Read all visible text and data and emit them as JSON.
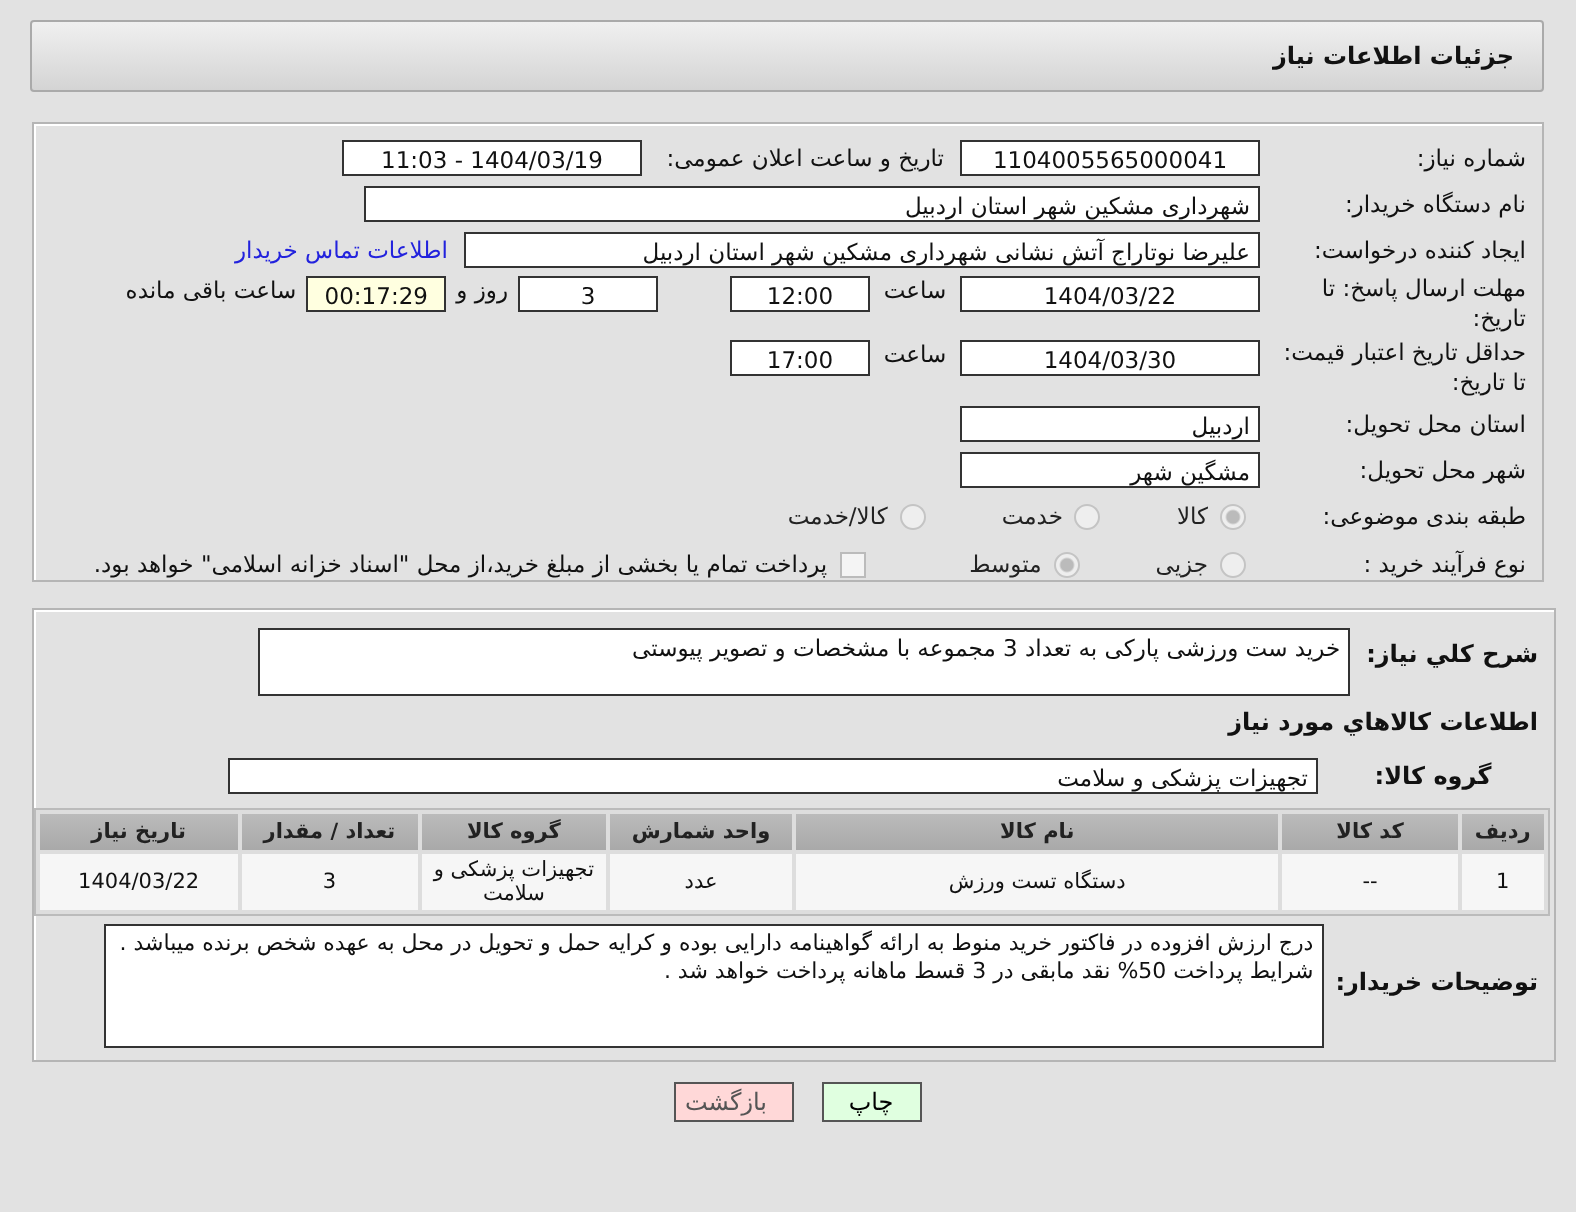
{
  "header": {
    "title": "جزئیات اطلاعات نیاز"
  },
  "need_number": {
    "label": "شماره نیاز:",
    "value": "1104005565000041"
  },
  "announce": {
    "label": "تاریخ و ساعت اعلان عمومی:",
    "value": "1404/03/19 - 11:03"
  },
  "buyer_org": {
    "label": "نام دستگاه خریدار:",
    "value": "شهرداری مشکین شهر استان اردبیل"
  },
  "requester": {
    "label": "ایجاد کننده درخواست:",
    "value": "علیرضا نوتاراج آتش نشانی شهرداری مشکین شهر استان اردبیل",
    "link": "اطلاعات تماس خریدار"
  },
  "deadline": {
    "label": "مهلت ارسال پاسخ: تا تاریخ:",
    "date": "1404/03/22",
    "time_label": "ساعت",
    "time": "12:00",
    "days": "3",
    "days_label": "روز و",
    "remaining": "00:17:29",
    "remaining_label": "ساعت باقی مانده"
  },
  "validity": {
    "label": "حداقل تاریخ اعتبار قیمت: تا تاریخ:",
    "date": "1404/03/30",
    "time_label": "ساعت",
    "time": "17:00"
  },
  "province": {
    "label": "استان محل تحویل:",
    "value": "اردبیل"
  },
  "city": {
    "label": "شهر محل تحویل:",
    "value": "مشگین شهر"
  },
  "category": {
    "label": "طبقه بندی موضوعی:",
    "options": [
      {
        "label": "کالا",
        "selected": true
      },
      {
        "label": "خدمت",
        "selected": false
      },
      {
        "label": "کالا/خدمت",
        "selected": false
      }
    ]
  },
  "purchase_type": {
    "label": "نوع فرآیند خرید :",
    "options": [
      {
        "label": "جزیی",
        "selected": false
      },
      {
        "label": "متوسط",
        "selected": true
      }
    ],
    "treasury": {
      "label": "پرداخت تمام یا بخشی از مبلغ خرید،از محل \"اسناد خزانه اسلامی\" خواهد بود.",
      "checked": false
    }
  },
  "description": {
    "label": "شرح کلي نياز:",
    "value": "خرید ست ورزشی پارکی به تعداد 3 مجموعه با مشخصات و تصویر پیوستی"
  },
  "goods_section": {
    "title": "اطلاعات کالاهاي مورد نياز"
  },
  "goods_group": {
    "label": "گروه کالا:",
    "value": "تجهیزات پزشکی و سلامت"
  },
  "table": {
    "columns": [
      "ردیف",
      "کد کالا",
      "نام کالا",
      "واحد شمارش",
      "گروه کالا",
      "تعداد / مقدار",
      "تاریخ نیاز"
    ],
    "rows": [
      [
        "1",
        "--",
        "دستگاه تست ورزش",
        "عدد",
        "تجهیزات پزشکی و سلامت",
        "3",
        "1404/03/22"
      ]
    ]
  },
  "notes": {
    "label": "توضیحات خریدار:",
    "value": "درج ارزش افزوده در فاکتور خرید منوط به ارائه گواهینامه دارایی بوده و کرایه حمل و تحویل در محل به عهده شخص برنده میباشد . شرایط پرداخت 50% نقد مابقی در 3 قسط ماهانه پرداخت خواهد شد ."
  },
  "buttons": [
    {
      "label": "چاپ",
      "kind": "print"
    },
    {
      "label": "بازگشت",
      "kind": "back"
    }
  ]
}
